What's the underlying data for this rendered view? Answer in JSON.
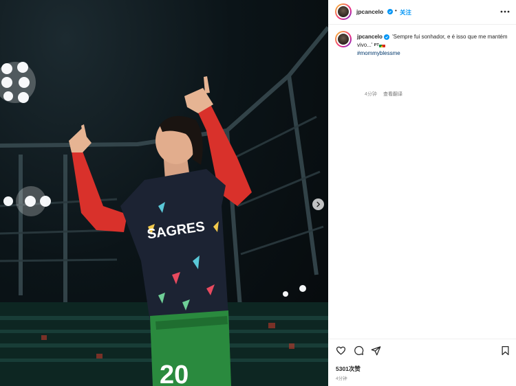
{
  "post": {
    "image_alt": "Footballer in a dark Portugal warm-up jersey with SAGRES sponsor and number 20 green shorts, pointing both index fingers to the sky in a floodlit stadium",
    "jersey_sponsor": "SAGRES",
    "shorts_number": "20"
  },
  "header": {
    "username": "jpcancelo",
    "dot": "•",
    "follow_label": "关注"
  },
  "caption": {
    "username": "jpcancelo",
    "text": "'Sempre fui sonhador, e é isso que me mantém vivo...'",
    "lang": "PT",
    "hashtag": "#mommyblessme",
    "age": "4分钟",
    "see_translation": "查看翻译"
  },
  "actions": {
    "likes": "5301次赞",
    "time": "4分钟"
  },
  "colors": {
    "accent": "#0095f6",
    "hashtag": "#00376b",
    "muted": "#8e8e8e",
    "jersey_red": "#d9312b",
    "shorts_green": "#2a8a3e"
  }
}
